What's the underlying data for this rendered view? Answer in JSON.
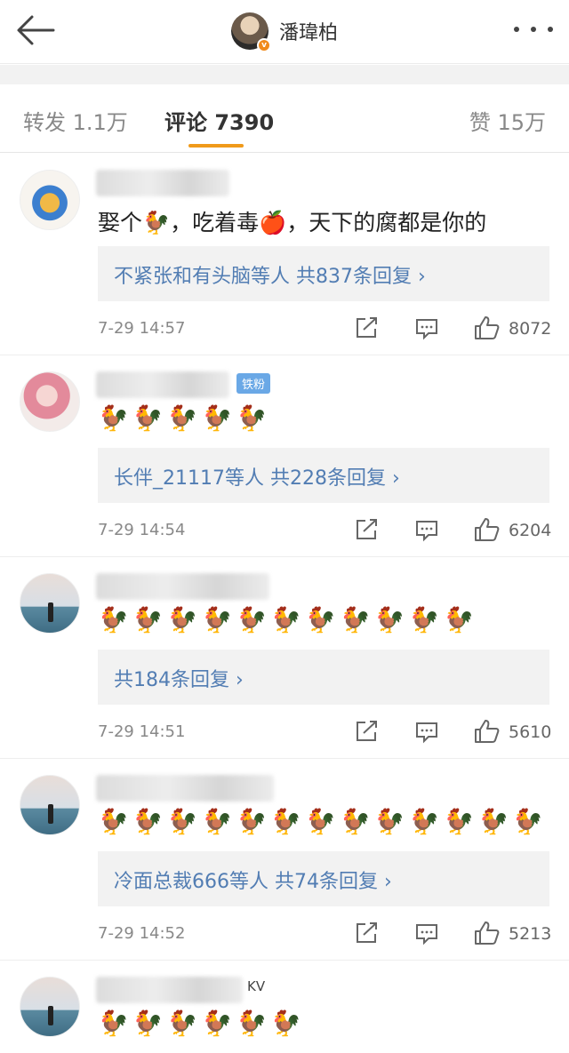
{
  "header": {
    "name": "潘瑋柏",
    "badge": "v"
  },
  "tabs": {
    "repost": "转发 1.1万",
    "comments": "评论 7390",
    "likes": "赞 15万"
  },
  "comments": [
    {
      "text": "娶个🐓，吃着毒🍎，天下的腐都是你的",
      "replies": "不紧张和有头脑等人  共837条回复 ›",
      "time": "7-29 14:57",
      "likes": "8072"
    },
    {
      "fan_badge": "铁粉",
      "chickens": "🐓🐓🐓🐓🐓",
      "replies": "长伴_21117等人  共228条回复 ›",
      "time": "7-29 14:54",
      "likes": "6204"
    },
    {
      "chickens": "🐓🐓🐓🐓🐓🐓🐓🐓🐓🐓🐓",
      "replies": "共184条回复 ›",
      "time": "7-29 14:51",
      "likes": "5610"
    },
    {
      "chickens": "🐓🐓🐓🐓🐓🐓🐓🐓🐓🐓🐓🐓🐓",
      "replies": "冷面总裁666等人  共74条回复 ›",
      "time": "7-29 14:52",
      "likes": "5213"
    },
    {
      "user_suffix": "KV",
      "chickens": "🐓🐓🐓🐓🐓🐓"
    }
  ],
  "icons": {
    "back": "back-arrow-icon",
    "more": "more-dots-icon",
    "repost": "repost-icon",
    "comment": "comment-icon",
    "like": "thumbs-up-icon"
  },
  "colors": {
    "accent": "#f09a1a",
    "link": "#527db3",
    "verified": "#f08a1c",
    "fan_badge": "#6aa8e6"
  }
}
